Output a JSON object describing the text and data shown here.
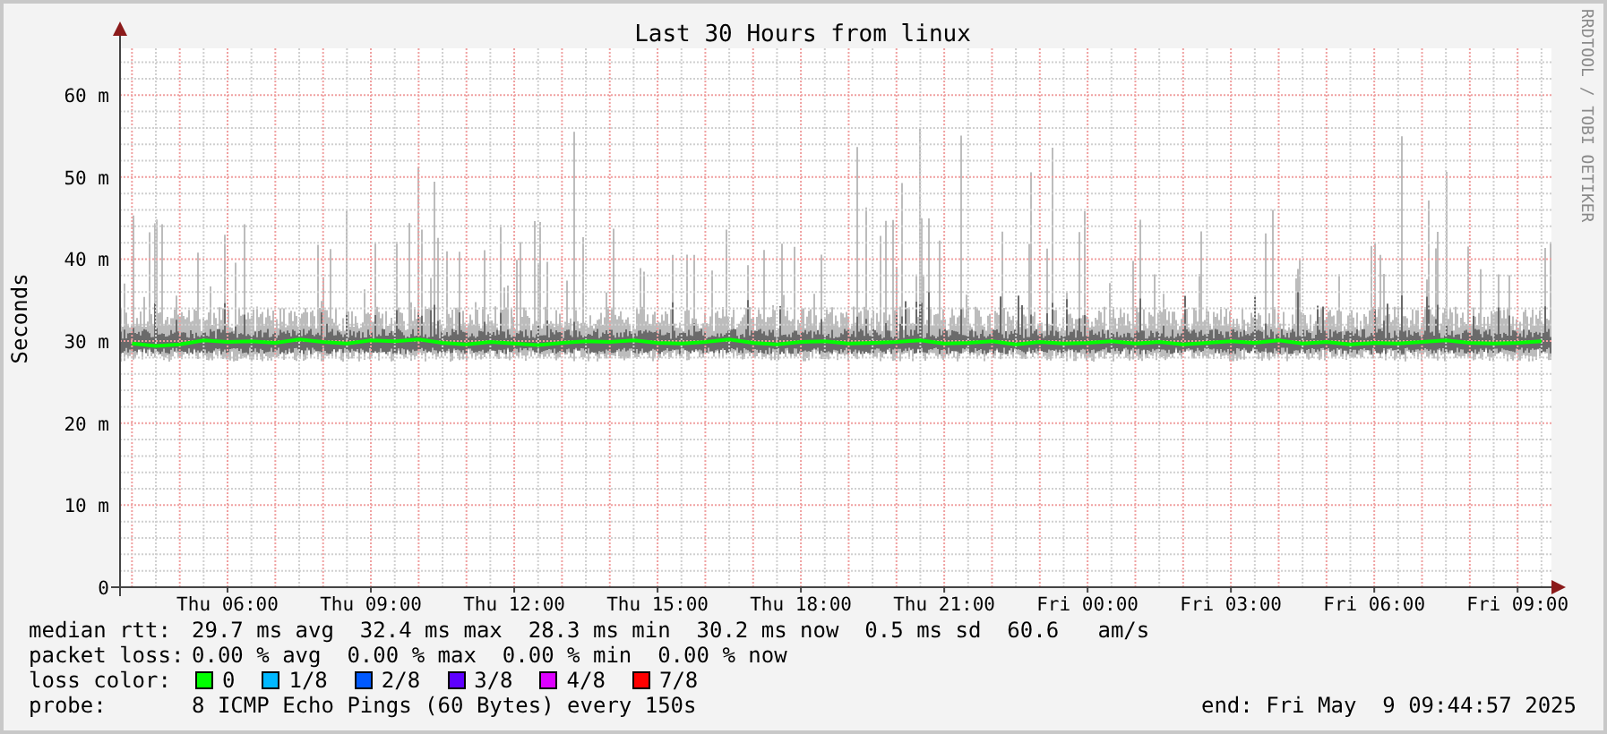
{
  "chart": {
    "chart_data": {
      "type": "line",
      "grid": true,
      "title": "Last 30 Hours from linux",
      "ylabel": "Seconds",
      "ylim": [
        0,
        65.7
      ],
      "yticks": [
        {
          "value": 0,
          "label": "0"
        },
        {
          "value": 10,
          "label": "10 m"
        },
        {
          "value": 20,
          "label": "20 m"
        },
        {
          "value": 30,
          "label": "30 m"
        },
        {
          "value": 40,
          "label": "40 m"
        },
        {
          "value": 50,
          "label": "50 m"
        },
        {
          "value": 60,
          "label": "60 m"
        }
      ],
      "categories": [
        null,
        null,
        null,
        null,
        "Thu 06:00",
        null,
        null,
        null,
        null,
        null,
        "Thu 09:00",
        null,
        null,
        null,
        null,
        null,
        "Thu 12:00",
        null,
        null,
        null,
        null,
        null,
        "Thu 15:00",
        null,
        null,
        null,
        null,
        null,
        "Thu 18:00",
        null,
        null,
        null,
        null,
        null,
        "Thu 21:00",
        null,
        null,
        null,
        null,
        null,
        "Fri 00:00",
        null,
        null,
        null,
        null,
        null,
        "Fri 03:00",
        null,
        null,
        null,
        null,
        null,
        "Fri 06:00",
        null,
        null,
        null,
        null,
        null,
        "Fri 09:00",
        null
      ],
      "series": [
        {
          "color": "#00ff00",
          "values": [
            29.7,
            29.4,
            29.6,
            30.1,
            29.9,
            30.0,
            29.8,
            30.2,
            29.9,
            29.7,
            30.1,
            30.0,
            30.2,
            29.8,
            29.6,
            29.9,
            29.7,
            29.5,
            29.8,
            30.0,
            29.9,
            30.1,
            29.8,
            29.7,
            29.9,
            30.2,
            29.8,
            29.6,
            29.9,
            30.0,
            29.7,
            29.8,
            29.9,
            30.1,
            29.7,
            29.8,
            30.0,
            29.6,
            29.9,
            29.7,
            29.8,
            30.0,
            29.7,
            29.9,
            29.6,
            29.8,
            30.0,
            29.8,
            30.1,
            29.7,
            29.9,
            29.6,
            29.8,
            29.7,
            29.9,
            30.1,
            29.8,
            29.7,
            29.8,
            30.0
          ]
        }
      ]
    },
    "credit": "RRDTOOL / TOBI OETIKER"
  },
  "legend": {
    "median_rtt": {
      "label": "median rtt:",
      "text": "29.7 ms avg  32.4 ms max  28.3 ms min  30.2 ms now  0.5 ms sd  60.6   am/s"
    },
    "packet_loss": {
      "label": "packet loss:",
      "text": "0.00 % avg  0.00 % max  0.00 % min  0.00 % now"
    },
    "loss_color": {
      "label": "loss color:",
      "items": [
        {
          "label": "0",
          "color": "#00ff00"
        },
        {
          "label": "1/8",
          "color": "#00b8ff"
        },
        {
          "label": "2/8",
          "color": "#0059ff"
        },
        {
          "label": "3/8",
          "color": "#5e00ff"
        },
        {
          "label": "4/8",
          "color": "#dd00ff"
        },
        {
          "label": "7/8",
          "color": "#ff0000"
        }
      ]
    },
    "probe": {
      "label": "probe:",
      "text": "8 ICMP Echo Pings (60 Bytes) every 150s"
    },
    "end": "end: Fri May  9 09:44:57 2025"
  }
}
